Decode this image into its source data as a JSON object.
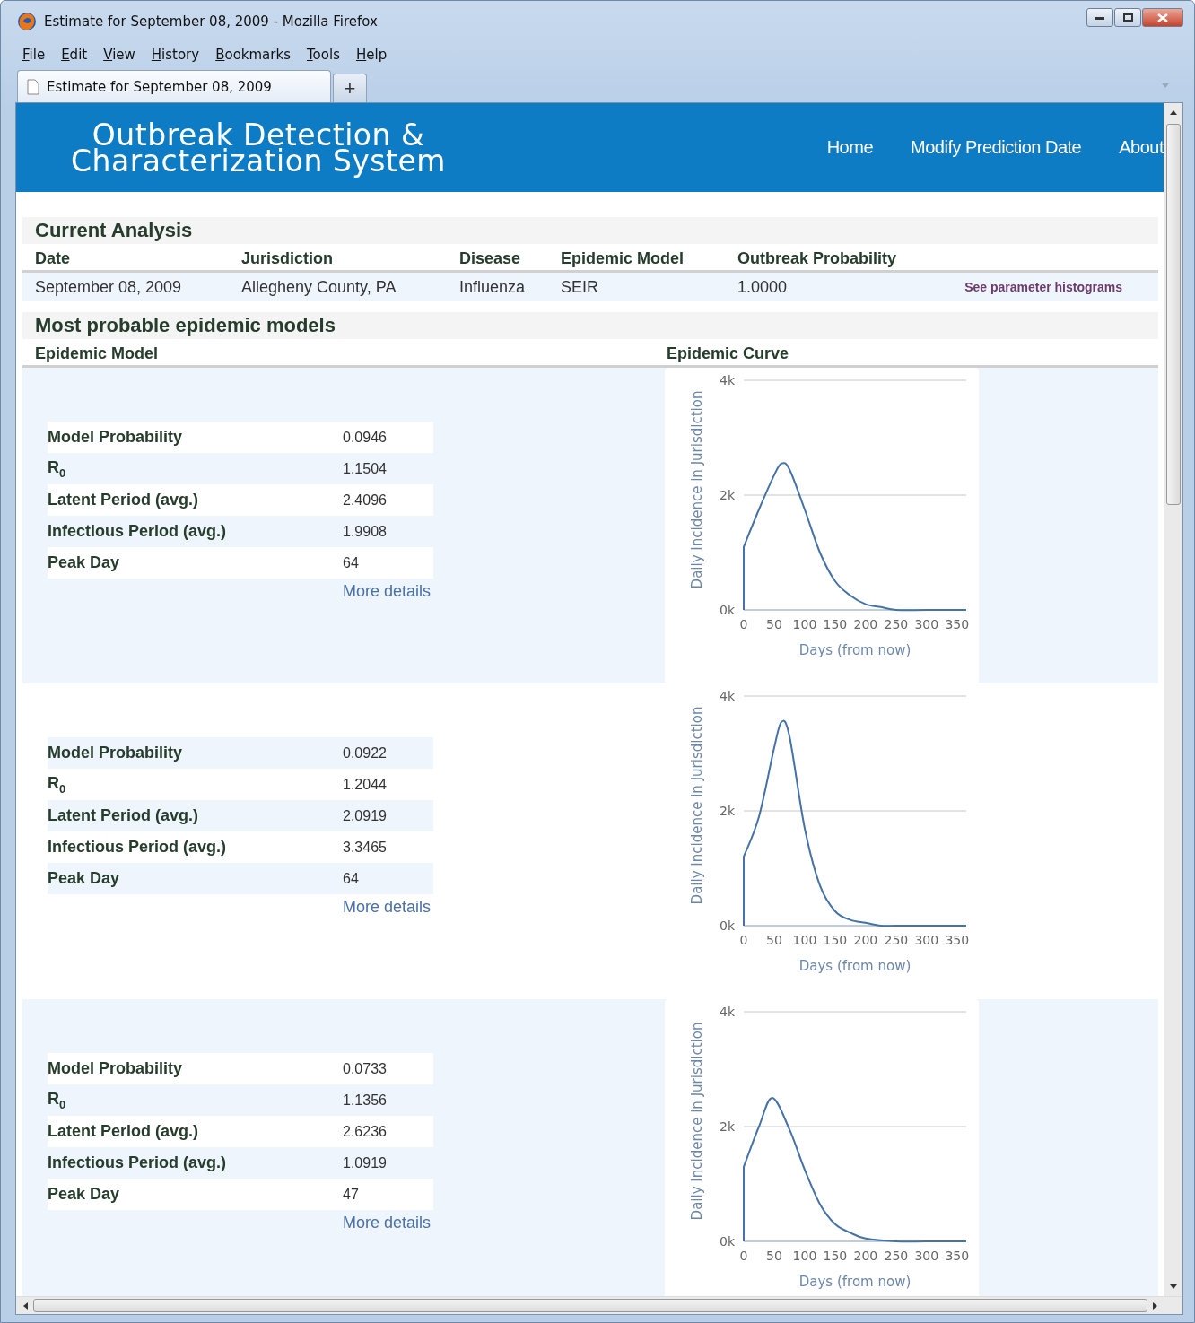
{
  "window": {
    "title": "Estimate for September 08, 2009 - Mozilla Firefox"
  },
  "menu": [
    {
      "label": "File"
    },
    {
      "label": "Edit"
    },
    {
      "label": "View"
    },
    {
      "label": "History"
    },
    {
      "label": "Bookmarks"
    },
    {
      "label": "Tools"
    },
    {
      "label": "Help"
    }
  ],
  "tabs": [
    {
      "label": "Estimate for September 08, 2009",
      "selected": true
    }
  ],
  "new_tab_button": "+",
  "header": {
    "title": "Outbreak Detection & Characterization System",
    "nav": [
      {
        "label": "Home"
      },
      {
        "label": "Modify Prediction Date"
      },
      {
        "label": "About"
      }
    ]
  },
  "current_analysis": {
    "heading": "Current Analysis",
    "columns": [
      "Date",
      "Jurisdiction",
      "Disease",
      "Epidemic Model",
      "Outbreak Probability"
    ],
    "row": [
      "September 08, 2009",
      "Allegheny County, PA",
      "Influenza",
      "SEIR",
      "1.0000"
    ],
    "link": "See parameter histograms"
  },
  "models": {
    "heading": "Most probable epidemic models",
    "columns": [
      "Epidemic Model",
      "Epidemic Curve"
    ],
    "items": [
      {
        "params": [
          {
            "label": "Model Probability",
            "value": "0.0946"
          },
          {
            "label": "R$_{0}$",
            "value": "1.1504"
          },
          {
            "label": "Latent Period (avg.)",
            "value": "2.4096"
          },
          {
            "label": "Infectious Period (avg.)",
            "value": "1.9908"
          },
          {
            "label": "Peak Day",
            "value": "64"
          }
        ],
        "more_link": "More details",
        "chart_data": {
          "type": "line",
          "xlabel": "Days (from now)",
          "ylabel": "Daily Incidence in Jurisdiction",
          "xlim": [
            0,
            365
          ],
          "ylim": [
            0,
            4000
          ],
          "xticks": [
            0,
            50,
            100,
            150,
            200,
            250,
            300,
            350
          ],
          "yticks": [
            {
              "value": 0,
              "label": "0k"
            },
            {
              "value": 2000,
              "label": "2k"
            },
            {
              "value": 4000,
              "label": "4k"
            }
          ],
          "x": [
            0,
            0,
            25,
            50,
            62,
            75,
            100,
            125,
            150,
            175,
            200,
            225,
            250,
            300,
            365
          ],
          "series": [
            {
              "color": "#4572a7",
              "values": [
                0,
                1100,
                1750,
                2350,
                2550,
                2450,
                1750,
                1000,
                500,
                250,
                100,
                50,
                0,
                0,
                0
              ]
            }
          ]
        }
      },
      {
        "params": [
          {
            "label": "Model Probability",
            "value": "0.0922"
          },
          {
            "label": "R$_{0}$",
            "value": "1.2044"
          },
          {
            "label": "Latent Period (avg.)",
            "value": "2.0919"
          },
          {
            "label": "Infectious Period (avg.)",
            "value": "3.3465"
          },
          {
            "label": "Peak Day",
            "value": "64"
          }
        ],
        "more_link": "More details",
        "chart_data": {
          "type": "line",
          "xlabel": "Days (from now)",
          "ylabel": "Daily Incidence in Jurisdiction",
          "xlim": [
            0,
            365
          ],
          "ylim": [
            0,
            4000
          ],
          "xticks": [
            0,
            50,
            100,
            150,
            200,
            250,
            300,
            350
          ],
          "yticks": [
            {
              "value": 0,
              "label": "0k"
            },
            {
              "value": 2000,
              "label": "2k"
            },
            {
              "value": 4000,
              "label": "4k"
            }
          ],
          "x": [
            0,
            0,
            25,
            50,
            62,
            75,
            100,
            125,
            150,
            175,
            200,
            225,
            250,
            300,
            365
          ],
          "series": [
            {
              "color": "#4572a7",
              "values": [
                0,
                1200,
                1900,
                3100,
                3550,
                3300,
                1700,
                700,
                250,
                100,
                50,
                0,
                0,
                0,
                0
              ]
            }
          ]
        }
      },
      {
        "params": [
          {
            "label": "Model Probability",
            "value": "0.0733"
          },
          {
            "label": "R$_{0}$",
            "value": "1.1356"
          },
          {
            "label": "Latent Period (avg.)",
            "value": "2.6236"
          },
          {
            "label": "Infectious Period (avg.)",
            "value": "1.0919"
          },
          {
            "label": "Peak Day",
            "value": "47"
          }
        ],
        "more_link": "More details",
        "chart_data": {
          "type": "line",
          "xlabel": "Days (from now)",
          "ylabel": "Daily Incidence in Jurisdiction",
          "xlim": [
            0,
            365
          ],
          "ylim": [
            0,
            4000
          ],
          "xticks": [
            0,
            50,
            100,
            150,
            200,
            250,
            300,
            350
          ],
          "yticks": [
            {
              "value": 0,
              "label": "0k"
            },
            {
              "value": 2000,
              "label": "2k"
            },
            {
              "value": 4000,
              "label": "4k"
            }
          ],
          "x": [
            0,
            0,
            25,
            47,
            75,
            100,
            125,
            150,
            175,
            200,
            250,
            300,
            365
          ],
          "series": [
            {
              "color": "#4572a7",
              "values": [
                0,
                1300,
                2000,
                2500,
                1950,
                1250,
                650,
                300,
                150,
                50,
                0,
                0,
                0
              ]
            }
          ]
        }
      }
    ]
  }
}
